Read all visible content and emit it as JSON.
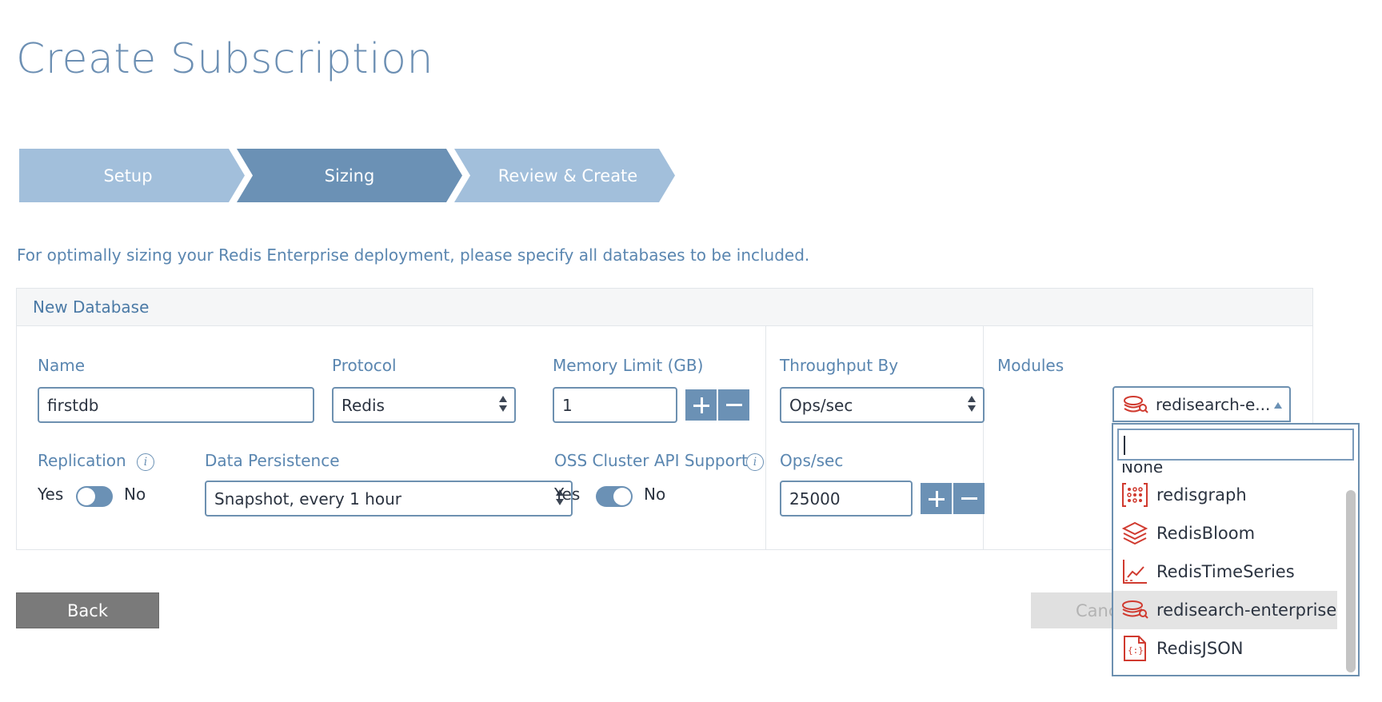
{
  "page": {
    "title": "Create Subscription"
  },
  "steps": [
    {
      "label": "Setup",
      "state": "done"
    },
    {
      "label": "Sizing",
      "state": "active"
    },
    {
      "label": "Review & Create",
      "state": "pending"
    }
  ],
  "intro": "For optimally sizing your Redis Enterprise deployment, please specify all databases to be included.",
  "panel": {
    "header": "New Database",
    "name": {
      "label": "Name",
      "value": "firstdb"
    },
    "protocol": {
      "label": "Protocol",
      "value": "Redis"
    },
    "memory": {
      "label": "Memory Limit (GB)",
      "value": "1"
    },
    "throughput_by": {
      "label": "Throughput By",
      "value": "Ops/sec"
    },
    "modules": {
      "label": "Modules",
      "value": "redisearch-e..."
    },
    "replication": {
      "label": "Replication",
      "yes": "Yes",
      "no": "No"
    },
    "persistence": {
      "label": "Data Persistence",
      "value": "Snapshot, every 1 hour"
    },
    "oss_cluster": {
      "label": "OSS Cluster API Support",
      "yes": "Yes",
      "no": "No"
    },
    "ops": {
      "label": "Ops/sec",
      "value": "25000"
    }
  },
  "buttons": {
    "back": "Back",
    "cancel": "Canc"
  },
  "modules_dropdown": {
    "search_value": "",
    "partial_item": "None",
    "items": [
      {
        "label": "redisgraph",
        "icon": "redisgraph-icon"
      },
      {
        "label": "RedisBloom",
        "icon": "redisbloom-icon"
      },
      {
        "label": "RedisTimeSeries",
        "icon": "redistimeseries-icon"
      },
      {
        "label": "redisearch-enterprise",
        "icon": "redisearch-icon",
        "selected": true
      },
      {
        "label": "RedisJSON",
        "icon": "redisjson-icon"
      }
    ]
  },
  "colors": {
    "accent": "#6b91b5",
    "step_light": "#a2bfdb",
    "module_icon": "#d03a2f",
    "title": "#6c8fb3"
  }
}
